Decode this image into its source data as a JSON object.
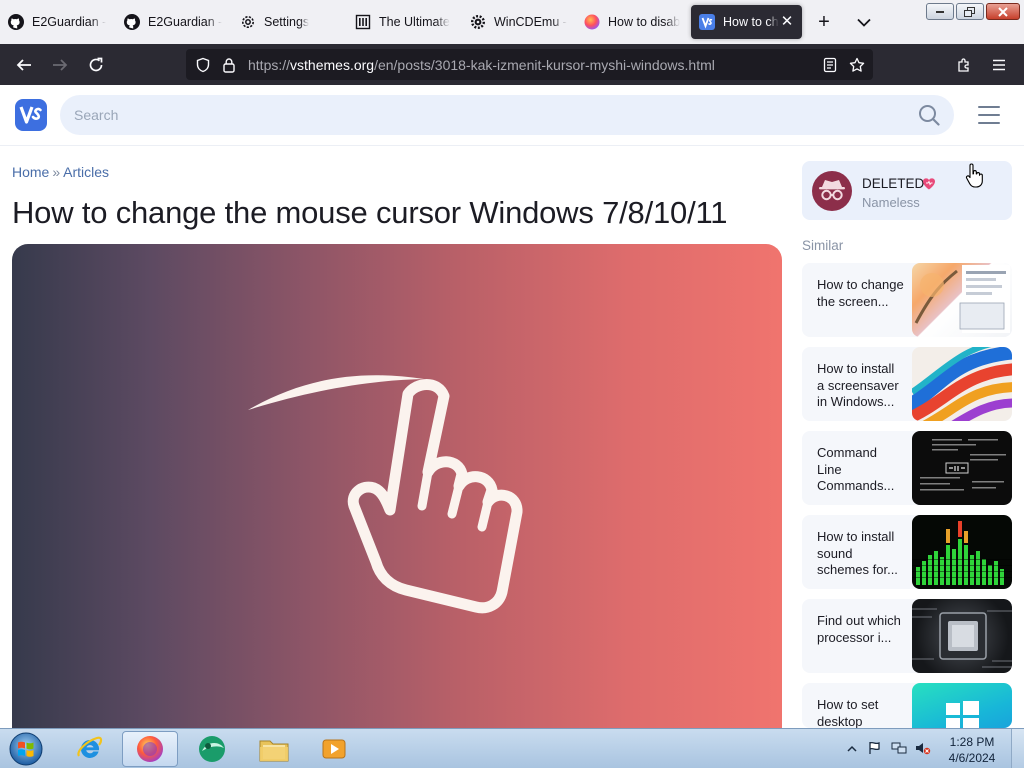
{
  "browser": {
    "tabs": [
      {
        "label": "E2Guardian -",
        "icon": "github-icon"
      },
      {
        "label": "E2Guardian -",
        "icon": "github-icon"
      },
      {
        "label": "Settings",
        "icon": "gear-icon"
      },
      {
        "label": "The Ultimate",
        "icon": "library-icon"
      },
      {
        "label": "WinCDEmu -",
        "icon": "cog-icon"
      },
      {
        "label": "How to disab",
        "icon": "firefox-icon"
      },
      {
        "label": "How to ch",
        "icon": "vsthemes-icon",
        "active": true
      }
    ],
    "new_tab_label": "+",
    "tab_list_label": "⌄",
    "url": {
      "scheme": "https://",
      "host": "vsthemes.org",
      "path": "/en/posts/3018-kak-izmenit-kursor-myshi-windows.html"
    }
  },
  "site": {
    "search_placeholder": "Search",
    "breadcrumb": {
      "home": "Home",
      "separator": "»",
      "section": "Articles"
    },
    "title": "How to change the mouse cursor Windows 7/8/10/11",
    "author": {
      "name": "DELETED",
      "subtitle": "Nameless"
    },
    "similar_heading": "Similar",
    "similar": [
      {
        "text": "How to change the screen...",
        "thumb": "screen-thumbnail"
      },
      {
        "text": "How to install a screensaver in Windows...",
        "thumb": "colorful-swirl-thumbnail"
      },
      {
        "text": "Command Line Commands...",
        "thumb": "command-line-thumbnail"
      },
      {
        "text": "How to install sound schemes for...",
        "thumb": "equalizer-thumbnail"
      },
      {
        "text": "Find out which processor i...",
        "thumb": "processor-thumbnail"
      },
      {
        "text": "How to set desktop",
        "thumb": "windows-logo-thumbnail"
      }
    ]
  },
  "taskbar": {
    "apps": [
      "internet-explorer-icon",
      "firefox-icon",
      "green-app-icon",
      "explorer-folder-icon",
      "media-player-icon"
    ],
    "clock_time": "1:28 PM",
    "clock_date": "4/6/2024"
  },
  "colors": {
    "accent": "#3d6fe0",
    "search_bg": "#eaf0fb",
    "hero_left": "#363a4c",
    "hero_right": "#f0746e",
    "browser_dark": "#2b2a33"
  }
}
